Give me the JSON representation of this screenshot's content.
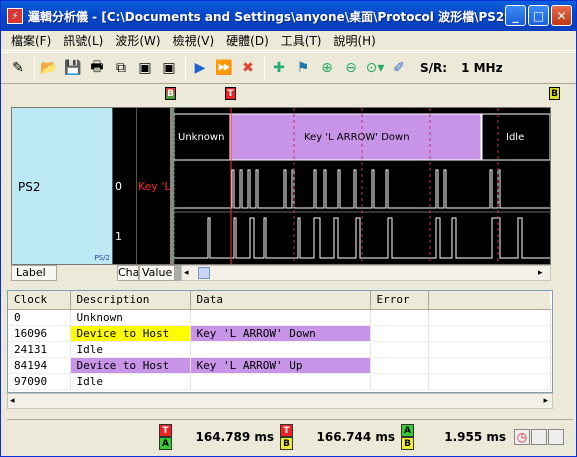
{
  "window": {
    "title": "邏輯分析儀 - [C:\\Documents and Settings\\anyone\\桌面\\Protocol 波形檔\\PS2波形...",
    "min": "_",
    "max": "□",
    "close": "✕"
  },
  "menu": [
    "檔案(F)",
    "訊號(L)",
    "波形(W)",
    "檢視(V)",
    "硬體(D)",
    "工具(T)",
    "說明(H)"
  ],
  "toolbar": {
    "sr_label": "S/R:",
    "sr_value": "1 MHz"
  },
  "markers": {
    "trigger": "T",
    "a": "B",
    "b": "B"
  },
  "wave": {
    "channel_name": "PS2",
    "channel_tag": "PS/2",
    "row0": "0",
    "row1": "1",
    "key_label": "Key 'L",
    "bus_segments": [
      {
        "text": "Unknown",
        "color": "#000000"
      },
      {
        "text": "Key 'L ARROW' Down",
        "color": "#c794e8"
      },
      {
        "text": "Idle",
        "color": "#000000"
      }
    ]
  },
  "tabs": {
    "label": "Label",
    "cha": "Cha",
    "value": "Value"
  },
  "grid": {
    "headers": [
      "Clock",
      "Description",
      "Data",
      "Error"
    ],
    "rows": [
      {
        "clock": "0",
        "desc": "Unknown",
        "data": "",
        "error": "",
        "desc_color": "",
        "data_color": ""
      },
      {
        "clock": "16096",
        "desc": "Device to Host",
        "data": "Key 'L ARROW' Down",
        "error": "",
        "desc_color": "#ffff00",
        "data_color": "#c794e8"
      },
      {
        "clock": "24131",
        "desc": "Idle",
        "data": "",
        "error": "",
        "desc_color": "",
        "data_color": ""
      },
      {
        "clock": "84194",
        "desc": "Device to Host",
        "data": "Key 'L ARROW' Up",
        "error": "",
        "desc_color": "#c794e8",
        "data_color": "#c794e8"
      },
      {
        "clock": "97090",
        "desc": "Idle",
        "data": "",
        "error": "",
        "desc_color": "",
        "data_color": ""
      }
    ]
  },
  "status": {
    "m1": {
      "top": "T",
      "bot": "A",
      "value": "164.789 ms"
    },
    "m2": {
      "top": "T",
      "bot": "B",
      "value": "166.744 ms"
    },
    "m3": {
      "top": "A",
      "bot": "B",
      "value": "1.955 ms"
    }
  }
}
